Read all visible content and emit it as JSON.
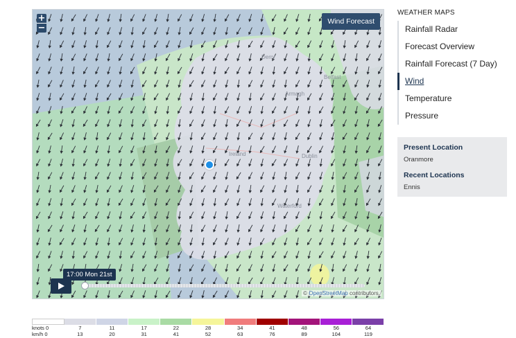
{
  "map": {
    "zoom_in": "+",
    "zoom_out": "−",
    "forecast_button": "Wind Forecast",
    "time_label": "17:00 Mon 21st",
    "attribution_prefix": "© ",
    "attribution_link": "OpenStreetMap",
    "attribution_suffix": " contributors.",
    "place_labels": [
      "Ireland",
      "Dublin",
      "Armagh",
      "Waterford",
      "Derry",
      "Belfast"
    ]
  },
  "sidebar": {
    "title": "WEATHER MAPS",
    "items": [
      {
        "label": "Rainfall Radar",
        "active": false
      },
      {
        "label": "Forecast Overview",
        "active": false
      },
      {
        "label": "Rainfall Forecast (7 Day)",
        "active": false
      },
      {
        "label": "Wind",
        "active": true
      },
      {
        "label": "Temperature",
        "active": false
      },
      {
        "label": "Pressure",
        "active": false
      }
    ]
  },
  "locations": {
    "present_title": "Present Location",
    "present_value": "Oranmore",
    "recent_title": "Recent Locations",
    "recent_value": "Ennis"
  },
  "legend": {
    "knots_label": "knots 0",
    "kmh_label": "km/h 0",
    "colors": [
      "#ffffff",
      "#dcdde6",
      "#cfd5e6",
      "#c9f2c8",
      "#a9dba4",
      "#f5f59a",
      "#f07c7c",
      "#a00000",
      "#a3147a",
      "#a81fd6",
      "#7b3fa8"
    ],
    "knots": [
      "7",
      "11",
      "17",
      "22",
      "28",
      "34",
      "41",
      "48",
      "56",
      "64"
    ],
    "kmh": [
      "13",
      "20",
      "31",
      "41",
      "52",
      "63",
      "76",
      "89",
      "104",
      "119"
    ]
  }
}
